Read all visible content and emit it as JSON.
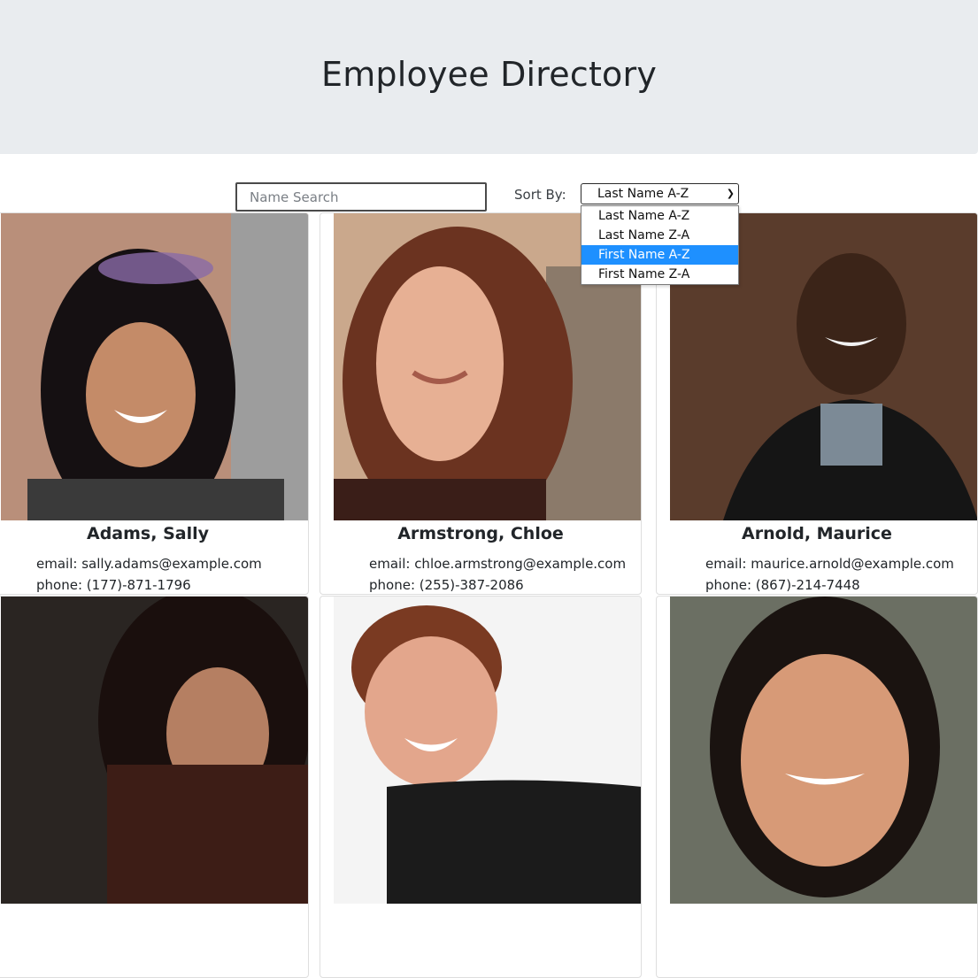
{
  "header": {
    "title": "Employee Directory"
  },
  "controls": {
    "search_placeholder": "Name Search",
    "sort_label": "Sort By:",
    "sort_selected": "Last Name A-Z",
    "sort_options": [
      "Last Name A-Z",
      "Last Name Z-A",
      "First Name A-Z",
      "First Name Z-A"
    ],
    "highlighted_option": "First Name A-Z"
  },
  "employees": [
    {
      "name": "Adams, Sally",
      "email": "email: sally.adams@example.com",
      "phone": "phone: (177)-871-1796",
      "photo_icon": "portrait-photo"
    },
    {
      "name": "Armstrong, Chloe",
      "email": "email: chloe.armstrong@example.com",
      "phone": "phone: (255)-387-2086",
      "photo_icon": "portrait-photo"
    },
    {
      "name": "Arnold, Maurice",
      "email": "email: maurice.arnold@example.com",
      "phone": "phone: (867)-214-7448",
      "photo_icon": "portrait-photo"
    },
    {
      "name": "",
      "email": "",
      "phone": "",
      "photo_icon": "portrait-photo"
    },
    {
      "name": "",
      "email": "",
      "phone": "",
      "photo_icon": "portrait-photo"
    },
    {
      "name": "",
      "email": "",
      "phone": "",
      "photo_icon": "portrait-photo"
    }
  ],
  "colors": {
    "header_bg": "#e9ecef",
    "highlight": "#1e90ff"
  }
}
